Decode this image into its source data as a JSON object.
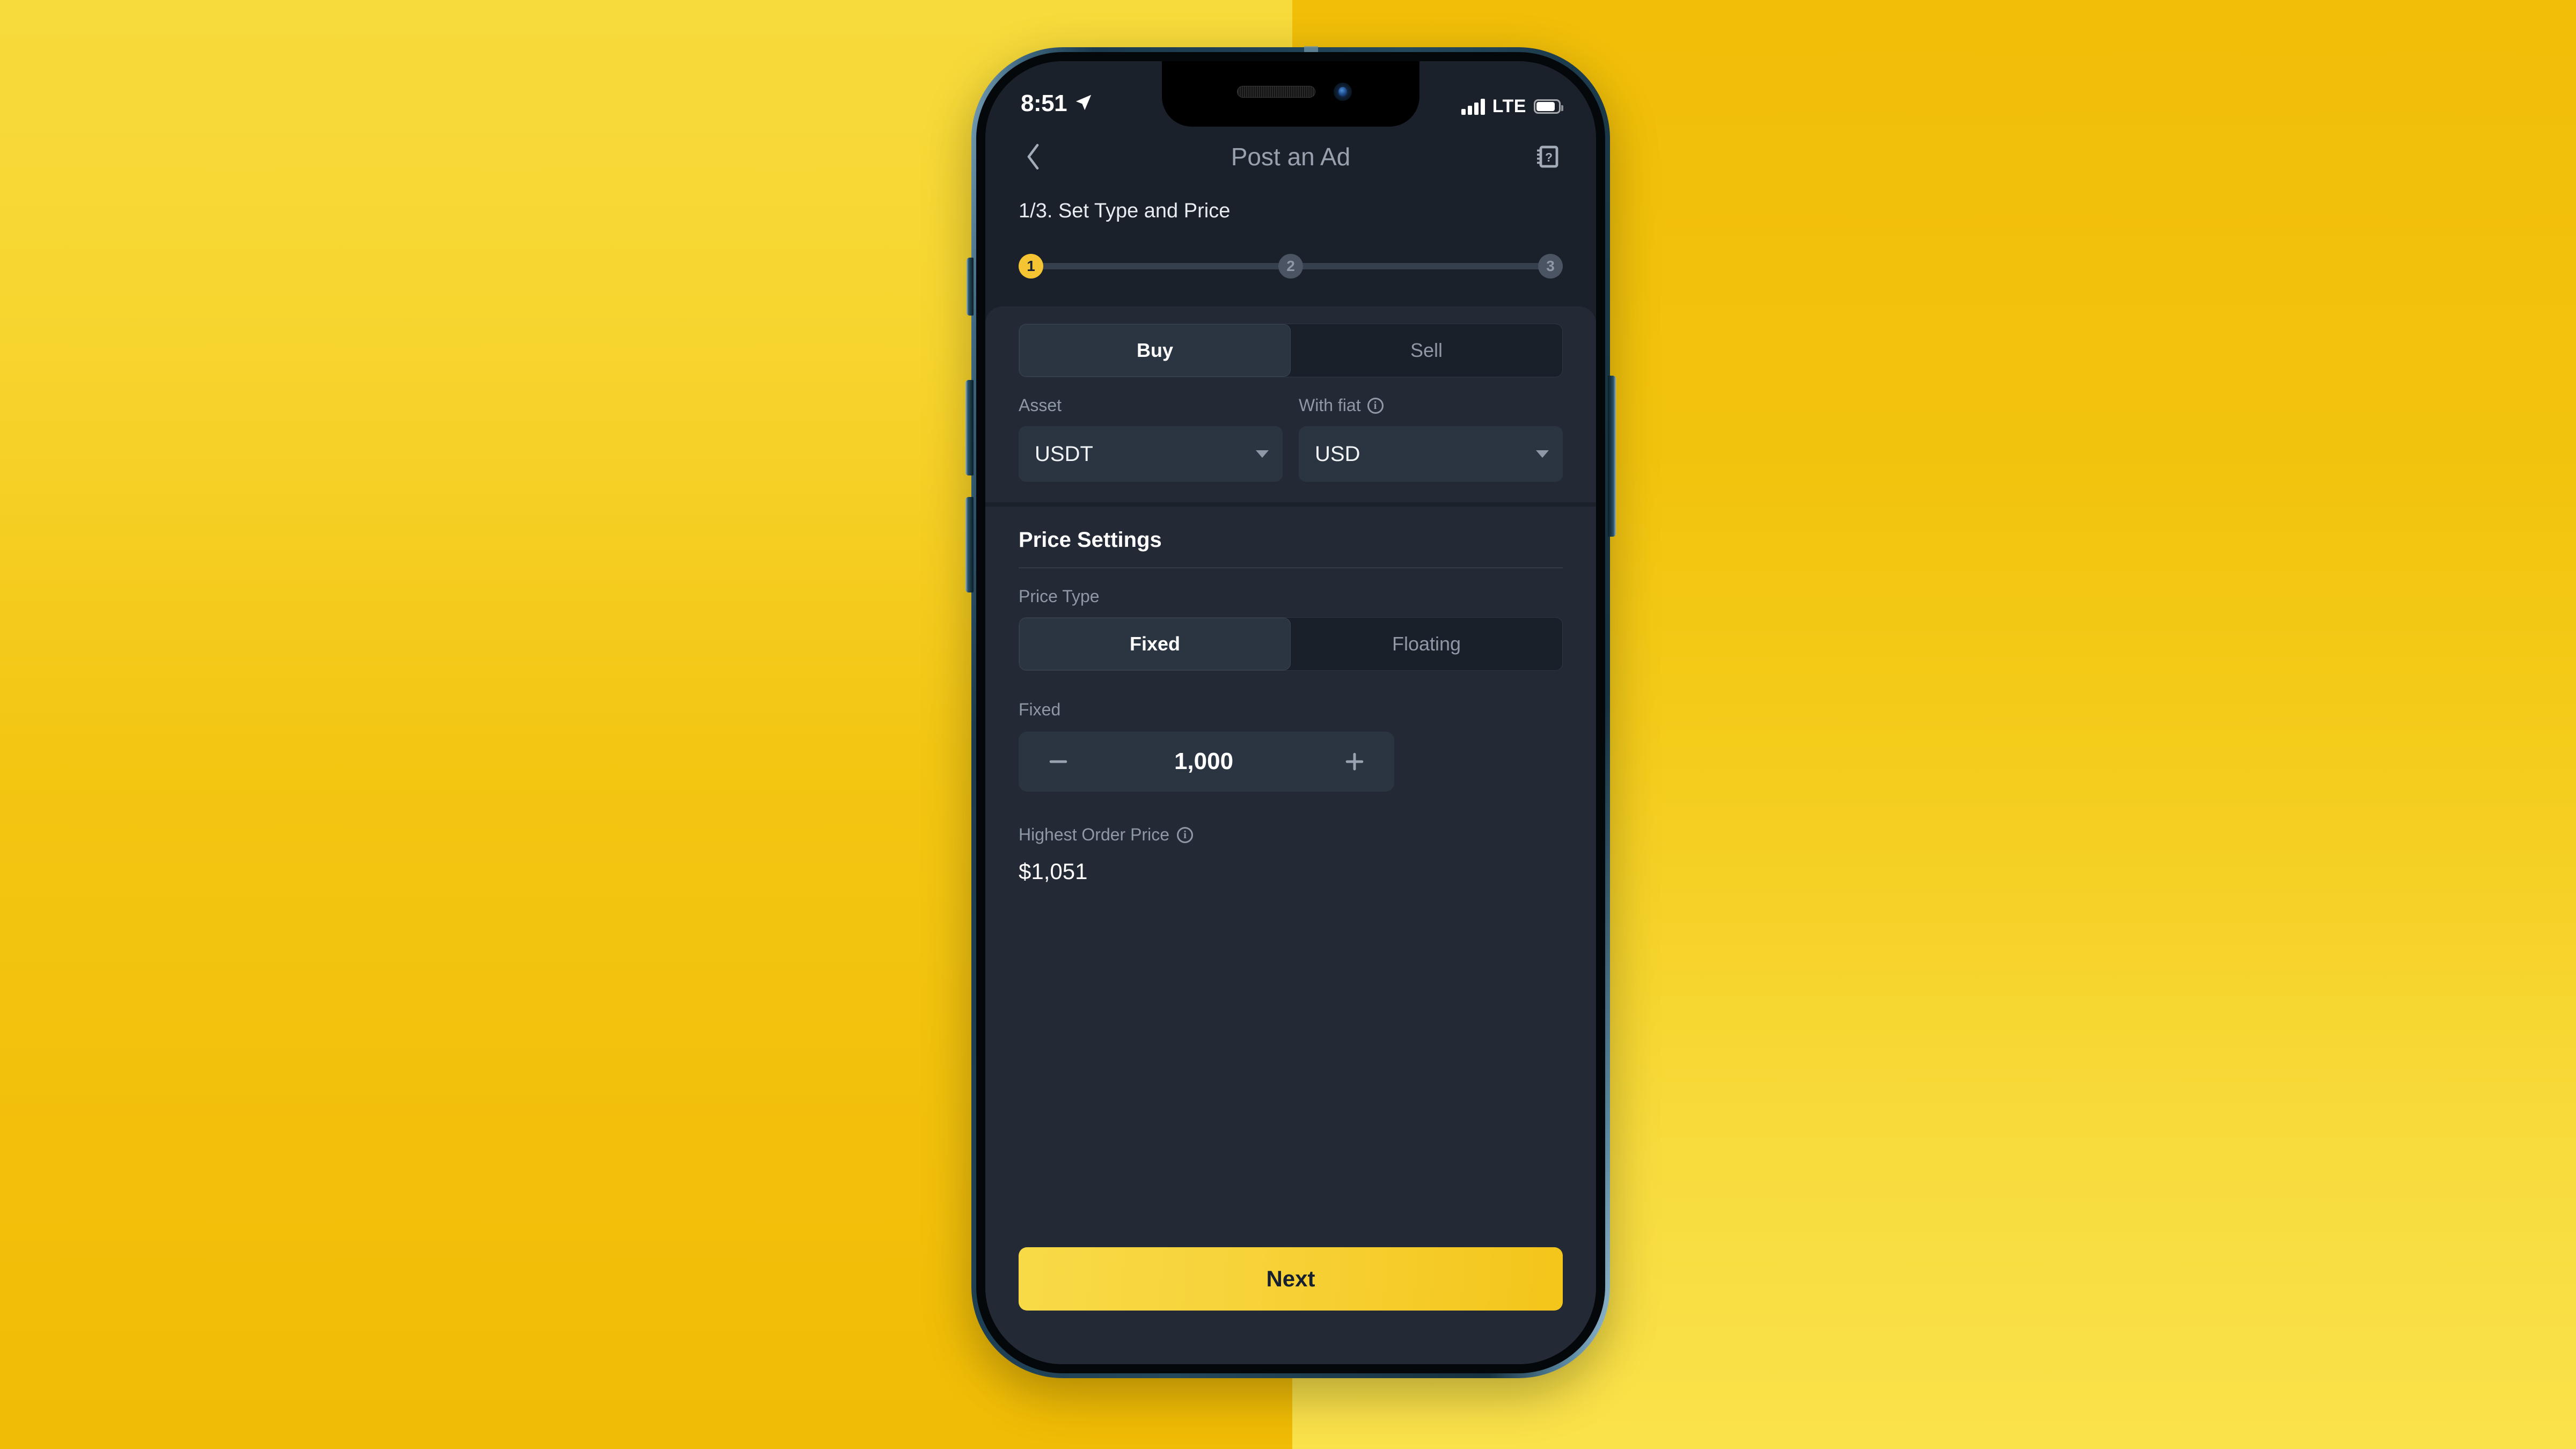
{
  "background": {
    "color_left": "#F7DB3C",
    "color_right": "#F1BE08",
    "color_base": "#F3C613"
  },
  "device": {
    "frame_color": "#24485C",
    "side_buttons": [
      "mute-switch",
      "volume-up",
      "volume-down",
      "power"
    ]
  },
  "status_bar": {
    "time": "8:51",
    "location_icon": "location-arrow-icon",
    "signal_icon": "cellular-signal-icon",
    "network": "LTE",
    "battery_icon": "battery-full-icon"
  },
  "nav": {
    "back_icon": "chevron-left-icon",
    "title": "Post an Ad",
    "help_icon": "help-guide-icon"
  },
  "step": {
    "title": "1/3. Set Type and Price",
    "dots": [
      {
        "label": "1",
        "state": "active"
      },
      {
        "label": "2",
        "state": "inactive"
      },
      {
        "label": "3",
        "state": "inactive"
      }
    ],
    "active_color": "#F5C432",
    "inactive_color": "#4A5462"
  },
  "trade_type": {
    "options": [
      {
        "label": "Buy",
        "selected": true
      },
      {
        "label": "Sell",
        "selected": false
      }
    ]
  },
  "asset_field": {
    "label": "Asset",
    "value": "USDT",
    "caret_icon": "chevron-down-icon"
  },
  "fiat_field": {
    "label": "With fiat",
    "info_icon": "info-icon",
    "value": "USD",
    "caret_icon": "chevron-down-icon"
  },
  "price_settings": {
    "section_title": "Price Settings",
    "price_type_label": "Price Type",
    "price_type_options": [
      {
        "label": "Fixed",
        "selected": true
      },
      {
        "label": "Floating",
        "selected": false
      }
    ],
    "fixed_label": "Fixed",
    "fixed_value": "1,000",
    "minus_icon": "minus-icon",
    "plus_icon": "plus-icon"
  },
  "highest_order_price": {
    "label": "Highest Order Price",
    "info_icon": "info-icon",
    "value": "$1,051"
  },
  "footer": {
    "next_label": "Next",
    "next_color": "#F4C51A"
  }
}
